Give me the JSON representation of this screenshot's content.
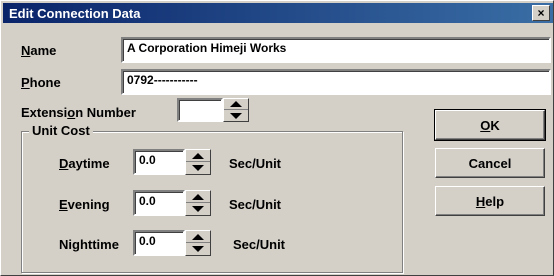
{
  "window": {
    "title": "Edit Connection Data",
    "close_symbol": "×"
  },
  "form": {
    "name": {
      "label_mnemonic": "N",
      "label_rest": "ame",
      "value": "A Corporation Himeji Works"
    },
    "phone": {
      "label_mnemonic": "P",
      "label_rest": "hone",
      "value": "0792-----------"
    },
    "extension": {
      "label_pre": "Extensi",
      "label_mnemonic": "o",
      "label_rest": "n Number",
      "value": ""
    }
  },
  "unit_cost": {
    "group_label": "Unit Cost",
    "unit_label": "Sec/Unit",
    "rows": [
      {
        "label_mnemonic": "D",
        "label_rest": "aytime",
        "value": "0.0"
      },
      {
        "label_mnemonic": "E",
        "label_rest": "vening",
        "value": "0.0"
      },
      {
        "label_pre": "Ni",
        "label_mnemonic": "g",
        "label_rest": "httime",
        "value": "0.0"
      }
    ]
  },
  "buttons": {
    "ok": {
      "mnemonic": "O",
      "rest": "K"
    },
    "cancel": {
      "label": "Cancel"
    },
    "help": {
      "mnemonic": "H",
      "rest": "elp"
    }
  }
}
